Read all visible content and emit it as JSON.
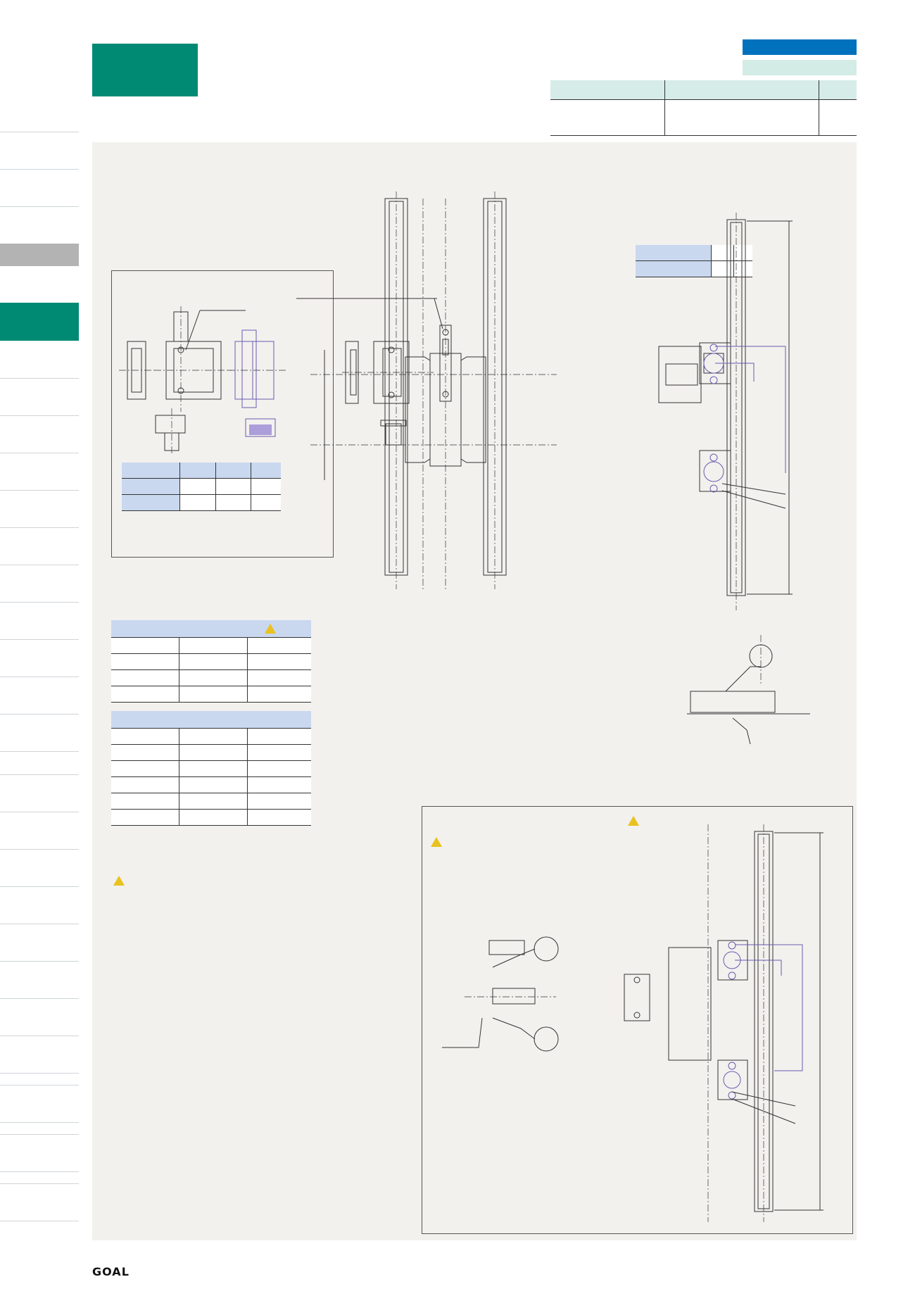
{
  "brand": {
    "logo_text": "GOAL"
  },
  "colors": {
    "accent_green": "#008a74",
    "tag_blue": "#0071bc",
    "tag_mint": "#d3ece5",
    "table_header_blue": "#c9d8ef",
    "drawing_purple": "#6a5bb0",
    "panel_bg": "#f3f1ee"
  },
  "icons": [
    "warning-icon",
    "warning-icon",
    "warning-icon",
    "warning-icon"
  ]
}
